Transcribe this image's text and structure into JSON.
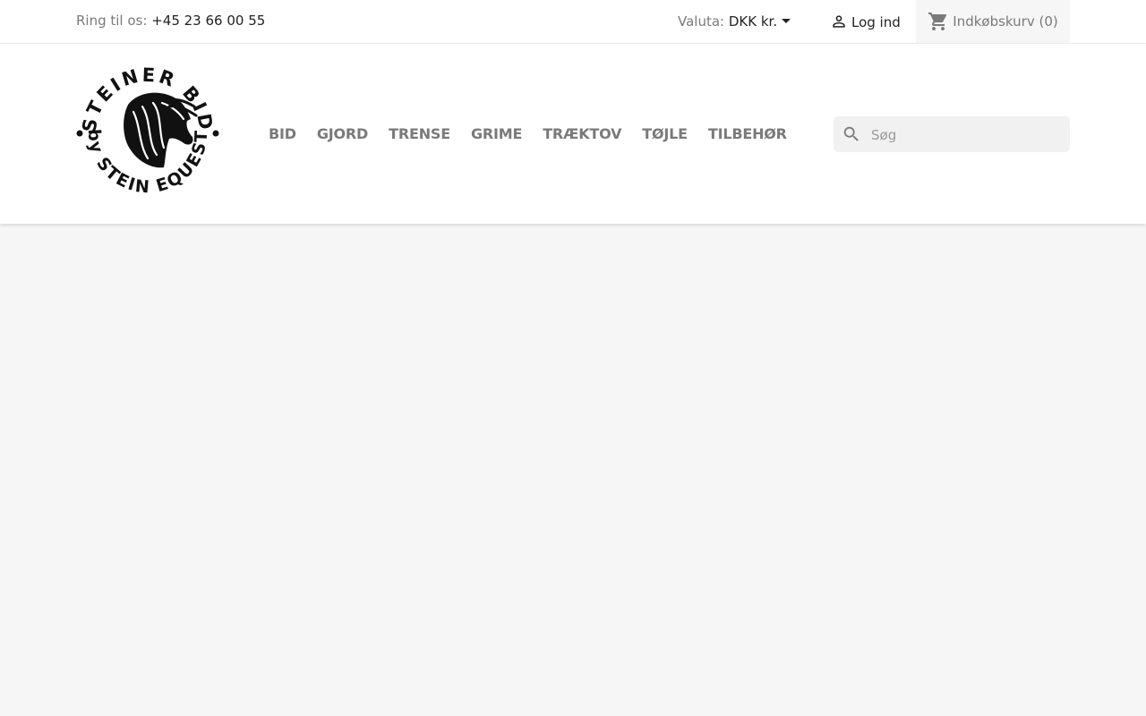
{
  "topbar": {
    "phone_label": "Ring til os:",
    "phone_number": "+45 23 66 00 55",
    "currency_label": "Valuta:",
    "currency_value": "DKK kr.",
    "login_label": "Log ind",
    "cart_label": "Indkøbskurv",
    "cart_count": "(0)"
  },
  "logo": {
    "text_top": "STEINER BID",
    "text_bottom": "by STEIN EQUEST"
  },
  "nav": {
    "items": [
      "BID",
      "GJORD",
      "TRENSE",
      "GRIME",
      "TRÆKTOV",
      "TØJLE",
      "TILBEHØR"
    ]
  },
  "search": {
    "placeholder": "Søg",
    "value": ""
  },
  "colors": {
    "page_bg": "#f6f6f6",
    "text": "#232323",
    "muted": "#7a7a7a"
  },
  "icons": {
    "login": "person-icon",
    "cart": "shopping-cart-icon",
    "search": "search-icon",
    "currency": "caret-down-icon"
  }
}
